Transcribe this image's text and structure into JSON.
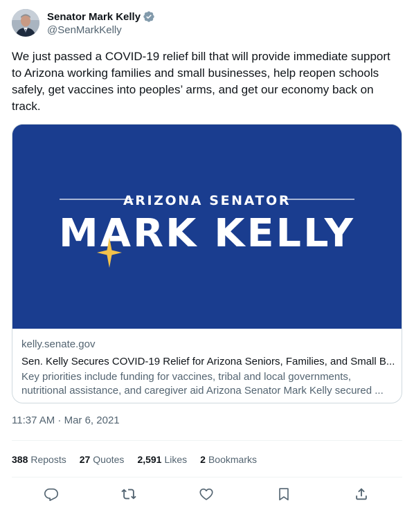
{
  "author": {
    "name": "Senator Mark Kelly",
    "handle": "@SenMarkKelly",
    "verified": true
  },
  "tweet": {
    "lines": [
      "We just passed a COVID-19 relief bill that will provide immediate support",
      "to Arizona working families and small businesses, help reopen schools",
      "safely, get vaccines into peoples’ arms, and get our economy back on",
      "track."
    ]
  },
  "card": {
    "image": {
      "overline": "ARIZONA SENATOR",
      "headline": "MARK KELLY",
      "background_color": "#1a3d8f",
      "star_color": "#f3c24a"
    },
    "domain": "kelly.senate.gov",
    "title": "Sen. Kelly Secures COVID-19 Relief for Arizona Seniors, Families, and Small B...",
    "description_lines": [
      "Key priorities include funding for vaccines, tribal and local governments,",
      "nutritional assistance, and caregiver aid Arizona Senator Mark Kelly secured ..."
    ]
  },
  "timestamp": "11:37 AM · Mar 6, 2021",
  "stats": [
    {
      "count": "388",
      "label": "Reposts"
    },
    {
      "count": "27",
      "label": "Quotes"
    },
    {
      "count": "2,591",
      "label": "Likes"
    },
    {
      "count": "2",
      "label": "Bookmarks"
    }
  ],
  "actions": [
    {
      "name": "reply-icon"
    },
    {
      "name": "repost-icon"
    },
    {
      "name": "like-icon"
    },
    {
      "name": "bookmark-icon"
    },
    {
      "name": "share-icon"
    }
  ],
  "colors": {
    "text_primary": "#0f1419",
    "text_secondary": "#536471",
    "verified_badge": "#829aab",
    "border": "#cfd9de"
  }
}
